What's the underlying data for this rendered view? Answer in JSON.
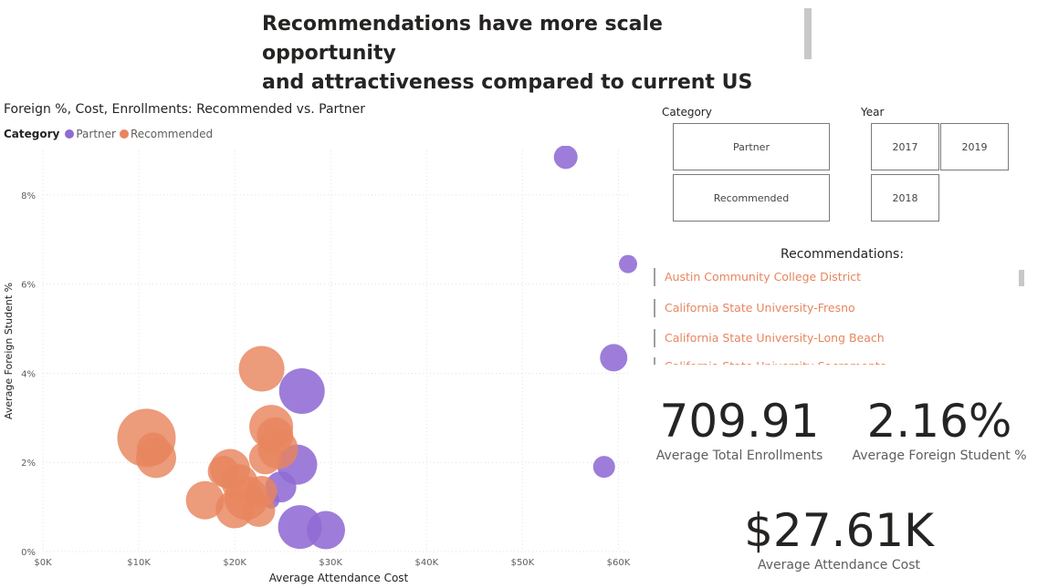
{
  "page_title": {
    "line1": "Recommendations have more scale opportunity",
    "line2": "and  attractiveness compared to current US"
  },
  "chart_data": {
    "type": "scatter",
    "title": "Foreign %, Cost, Enrollments: Recommended vs. Partner",
    "legend_title": "Category",
    "xlabel": "Average Attendance Cost",
    "ylabel": "Average Foreign Student %",
    "xlim": [
      0,
      61000
    ],
    "ylim": [
      0,
      9
    ],
    "x_ticks": [
      "$0K",
      "$10K",
      "$20K",
      "$30K",
      "$40K",
      "$50K",
      "$60K"
    ],
    "y_ticks": [
      "0%",
      "2%",
      "4%",
      "6%",
      "8%"
    ],
    "grid": true,
    "legend_position": "top-left",
    "series": [
      {
        "name": "Partner",
        "color": "#8f6bd4",
        "points": [
          {
            "x": 54500,
            "y": 8.85,
            "size": 13
          },
          {
            "x": 61000,
            "y": 6.45,
            "size": 10
          },
          {
            "x": 59500,
            "y": 4.35,
            "size": 15
          },
          {
            "x": 58500,
            "y": 1.9,
            "size": 12
          },
          {
            "x": 27000,
            "y": 3.6,
            "size": 25
          },
          {
            "x": 26500,
            "y": 1.95,
            "size": 22
          },
          {
            "x": 24800,
            "y": 1.45,
            "size": 17
          },
          {
            "x": 22000,
            "y": 1.25,
            "size": 11
          },
          {
            "x": 23800,
            "y": 1.15,
            "size": 9
          },
          {
            "x": 26800,
            "y": 0.55,
            "size": 24
          },
          {
            "x": 29500,
            "y": 0.48,
            "size": 21
          }
        ]
      },
      {
        "name": "Recommended",
        "color": "#e8855e",
        "points": [
          {
            "x": 10800,
            "y": 2.55,
            "size": 32
          },
          {
            "x": 11800,
            "y": 2.1,
            "size": 22
          },
          {
            "x": 11500,
            "y": 2.3,
            "size": 18
          },
          {
            "x": 22800,
            "y": 4.1,
            "size": 25
          },
          {
            "x": 23800,
            "y": 2.8,
            "size": 24
          },
          {
            "x": 24200,
            "y": 2.6,
            "size": 20
          },
          {
            "x": 24500,
            "y": 2.3,
            "size": 22
          },
          {
            "x": 23200,
            "y": 2.1,
            "size": 18
          },
          {
            "x": 19500,
            "y": 1.85,
            "size": 22
          },
          {
            "x": 18800,
            "y": 1.8,
            "size": 17
          },
          {
            "x": 20500,
            "y": 1.55,
            "size": 20
          },
          {
            "x": 21200,
            "y": 1.2,
            "size": 24
          },
          {
            "x": 20000,
            "y": 0.95,
            "size": 21
          },
          {
            "x": 22500,
            "y": 0.92,
            "size": 18
          },
          {
            "x": 16900,
            "y": 1.15,
            "size": 21
          },
          {
            "x": 22800,
            "y": 1.35,
            "size": 17
          }
        ]
      }
    ]
  },
  "slicers": {
    "category": {
      "title": "Category",
      "options": [
        "Partner",
        "Recommended"
      ]
    },
    "year": {
      "title": "Year",
      "options": [
        "2017",
        "2019",
        "2018"
      ]
    }
  },
  "recommendations": {
    "heading": "Recommendations:",
    "items": [
      "Austin Community College District",
      "California State University-Fresno",
      "California State University-Long Beach",
      "California State University-Sacramento"
    ]
  },
  "kpis": [
    {
      "value": "709.91",
      "label": "Average Total Enrollments"
    },
    {
      "value": "2.16%",
      "label": "Average Foreign Student %"
    },
    {
      "value": "$27.61K",
      "label": "Average Attendance Cost"
    }
  ],
  "colors": {
    "partner": "#8f6bd4",
    "recommended": "#e8855e",
    "text": "#252423"
  }
}
